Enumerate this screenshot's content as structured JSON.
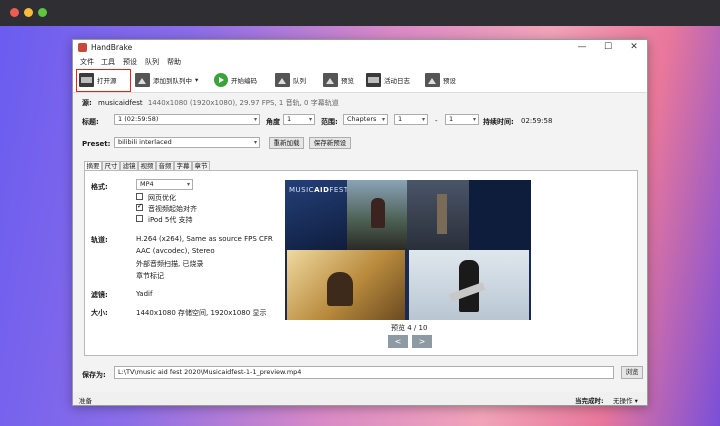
{
  "colors": {
    "accent": "#3aa33a",
    "highlight": "#e2231a",
    "mac_red": "#ee5c55",
    "mac_yellow": "#f6bd3b",
    "mac_green": "#5fc63f"
  },
  "window": {
    "title": "HandBrake",
    "controls": [
      "—",
      "☐",
      "✕"
    ]
  },
  "menu": [
    "文件",
    "工具",
    "预设",
    "队列",
    "帮助"
  ],
  "toolbar": {
    "open_source": "打开源",
    "add_to_queue": "添加到队列中",
    "start_encode": "开始编码",
    "queue": "队列",
    "preview": "预览",
    "activity_log": "活动日志",
    "presets": "预设"
  },
  "source": {
    "label": "源:",
    "name": "musicaidfest",
    "info": "1440x1080 (1920x1080), 29.97 FPS, 1 音轨, 0 字幕轨道"
  },
  "title_row": {
    "title_label": "标题:",
    "title_value": "1 (02:59:58)",
    "angle_label": "角度",
    "angle_value": "1",
    "range_label": "范围:",
    "range_value": "Chapters",
    "range_start": "1",
    "range_sep": "-",
    "range_end": "1",
    "duration_label": "持续时间:",
    "duration_value": "02:59:58"
  },
  "preset_row": {
    "label": "Preset:",
    "value": "bilibili interlaced",
    "reload": "重新加载",
    "save_new": "保存新预设"
  },
  "tabs": [
    "摘要",
    "尺寸",
    "滤镜",
    "视频",
    "音频",
    "字幕",
    "章节"
  ],
  "summary": {
    "format_label": "格式:",
    "format_value": "MP4",
    "web_optimized": "网页优化",
    "web_optimized_checked": false,
    "align_av": "音视频起始对齐",
    "align_av_checked": true,
    "ipod": "iPod 5代 支持",
    "ipod_checked": false,
    "tracks_label": "轨道:",
    "tracks": [
      "H.264 (x264), Same as source FPS CFR",
      "AAC (avcodec), Stereo",
      "外部音频扫描, 已烧录",
      "章节标记"
    ],
    "filters_label": "滤镜:",
    "filters_value": "Yadif",
    "size_label": "大小:",
    "size_value": "1440x1080 存储空间, 1920x1080 显示"
  },
  "preview": {
    "caption": "预览 4 / 10",
    "prev": "<",
    "next": ">",
    "logo_text_a": "MUSIC",
    "logo_text_b": "AID",
    "logo_text_c": "FEST"
  },
  "save": {
    "label": "保存为:",
    "path": "L:\\TV\\music aid fest 2020\\Musicaidfest-1-1_preview.mp4",
    "browse": "浏览"
  },
  "status": {
    "left": "准备",
    "when_done_label": "当完成时:",
    "when_done_value": "无操作 ▾"
  }
}
